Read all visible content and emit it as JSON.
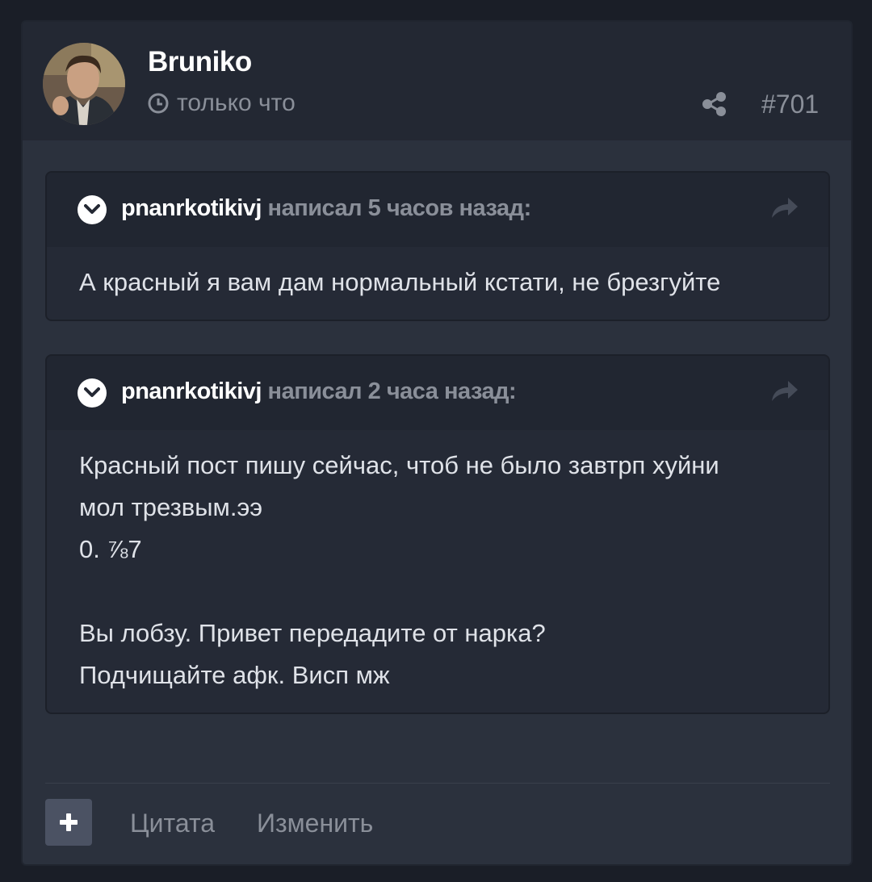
{
  "post": {
    "author": "Bruniko",
    "timestamp": "только что",
    "number": "#701",
    "icons": {
      "timestamp": "clock-icon",
      "share": "share-icon"
    }
  },
  "quotes": [
    {
      "user": "pnanrkotikivj",
      "meta": " написал 5 часов назад:",
      "lines": [
        "А красный я вам дам нормальный кстати, не брезгуйте"
      ],
      "icons": {
        "toggle": "chevron-down-icon",
        "jump": "reply-arrow-icon"
      }
    },
    {
      "user": "pnanrkotikivj",
      "meta": " написал 2 часа назад:",
      "lines": [
        "Красный пост пишу сейчас, чтоб не было завтрп хуйни",
        "мол трезвым.ээ",
        "0. ⅞7",
        "",
        "Вы лобзу. Привет передадите от нарка?",
        "Подчищайте афк. Висп мж"
      ],
      "icons": {
        "toggle": "chevron-down-icon",
        "jump": "reply-arrow-icon"
      }
    }
  ],
  "actions": {
    "add_icon": "plus-icon",
    "quote_label": "Цитата",
    "edit_label": "Изменить"
  },
  "colors": {
    "page_bg": "#1a1e27",
    "post_bg": "#2b313d",
    "header_bg": "#232833",
    "quote_bg": "#252a36",
    "muted_text": "#8a8f99",
    "body_text": "#dfe2e8"
  }
}
